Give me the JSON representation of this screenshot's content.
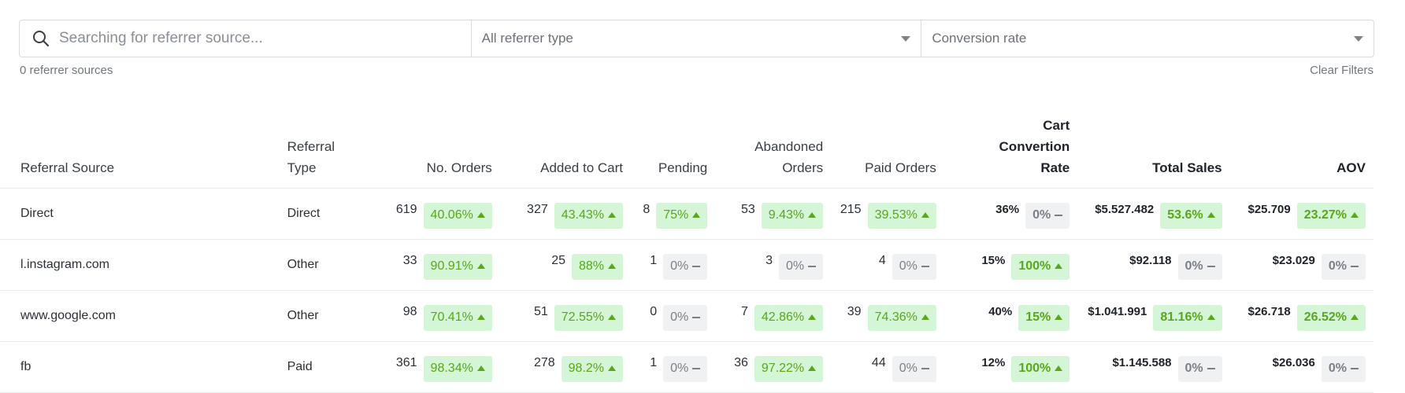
{
  "search": {
    "placeholder": "Searching for referrer source...",
    "value": ""
  },
  "filters": {
    "referrer_type": "All referrer type",
    "metric": "Conversion rate"
  },
  "summary": {
    "count": "0 referrer sources",
    "clear": "Clear Filters"
  },
  "colors": {
    "up_bg": "#d4f5d6",
    "up_text": "#5aa61c",
    "flat_bg": "#f0f1f3",
    "flat_text": "#7b8088"
  },
  "icons": {
    "search": "search-icon",
    "caret": "chevron-down-icon",
    "up": "trend-up-icon",
    "flat": "trend-flat-icon"
  },
  "columns": [
    {
      "label": "Referral Source"
    },
    {
      "label": "Referral Type"
    },
    {
      "label": "No. Orders"
    },
    {
      "label": "Added to Cart"
    },
    {
      "label": "Pending"
    },
    {
      "label": "Abandoned Orders"
    },
    {
      "label": "Paid Orders"
    },
    {
      "label": "Cart Convertion Rate"
    },
    {
      "label": "Total Sales"
    },
    {
      "label": "AOV"
    }
  ],
  "rows": [
    {
      "source": "Direct",
      "type": "Direct",
      "orders": {
        "value": "619",
        "change": "40.06%",
        "trend": "up"
      },
      "cart": {
        "value": "327",
        "change": "43.43%",
        "trend": "up"
      },
      "pending": {
        "value": "8",
        "change": "75%",
        "trend": "up"
      },
      "abandoned": {
        "value": "53",
        "change": "9.43%",
        "trend": "up"
      },
      "paid": {
        "value": "215",
        "change": "39.53%",
        "trend": "up"
      },
      "rate": {
        "value": "36%",
        "change": "0%",
        "trend": "flat"
      },
      "sales": {
        "value": "$5.527.482",
        "change": "53.6%",
        "trend": "up"
      },
      "aov": {
        "value": "$25.709",
        "change": "23.27%",
        "trend": "up"
      }
    },
    {
      "source": "l.instagram.com",
      "type": "Other",
      "orders": {
        "value": "33",
        "change": "90.91%",
        "trend": "up"
      },
      "cart": {
        "value": "25",
        "change": "88%",
        "trend": "up"
      },
      "pending": {
        "value": "1",
        "change": "0%",
        "trend": "flat"
      },
      "abandoned": {
        "value": "3",
        "change": "0%",
        "trend": "flat"
      },
      "paid": {
        "value": "4",
        "change": "0%",
        "trend": "flat"
      },
      "rate": {
        "value": "15%",
        "change": "100%",
        "trend": "up"
      },
      "sales": {
        "value": "$92.118",
        "change": "0%",
        "trend": "flat"
      },
      "aov": {
        "value": "$23.029",
        "change": "0%",
        "trend": "flat"
      }
    },
    {
      "source": "www.google.com",
      "type": "Other",
      "orders": {
        "value": "98",
        "change": "70.41%",
        "trend": "up"
      },
      "cart": {
        "value": "51",
        "change": "72.55%",
        "trend": "up"
      },
      "pending": {
        "value": "0",
        "change": "0%",
        "trend": "flat"
      },
      "abandoned": {
        "value": "7",
        "change": "42.86%",
        "trend": "up"
      },
      "paid": {
        "value": "39",
        "change": "74.36%",
        "trend": "up"
      },
      "rate": {
        "value": "40%",
        "change": "15%",
        "trend": "up"
      },
      "sales": {
        "value": "$1.041.991",
        "change": "81.16%",
        "trend": "up"
      },
      "aov": {
        "value": "$26.718",
        "change": "26.52%",
        "trend": "up"
      }
    },
    {
      "source": "fb",
      "type": "Paid",
      "orders": {
        "value": "361",
        "change": "98.34%",
        "trend": "up"
      },
      "cart": {
        "value": "278",
        "change": "98.2%",
        "trend": "up"
      },
      "pending": {
        "value": "1",
        "change": "0%",
        "trend": "flat"
      },
      "abandoned": {
        "value": "36",
        "change": "97.22%",
        "trend": "up"
      },
      "paid": {
        "value": "44",
        "change": "0%",
        "trend": "flat"
      },
      "rate": {
        "value": "12%",
        "change": "100%",
        "trend": "up"
      },
      "sales": {
        "value": "$1.145.588",
        "change": "0%",
        "trend": "flat"
      },
      "aov": {
        "value": "$26.036",
        "change": "0%",
        "trend": "flat"
      }
    }
  ]
}
